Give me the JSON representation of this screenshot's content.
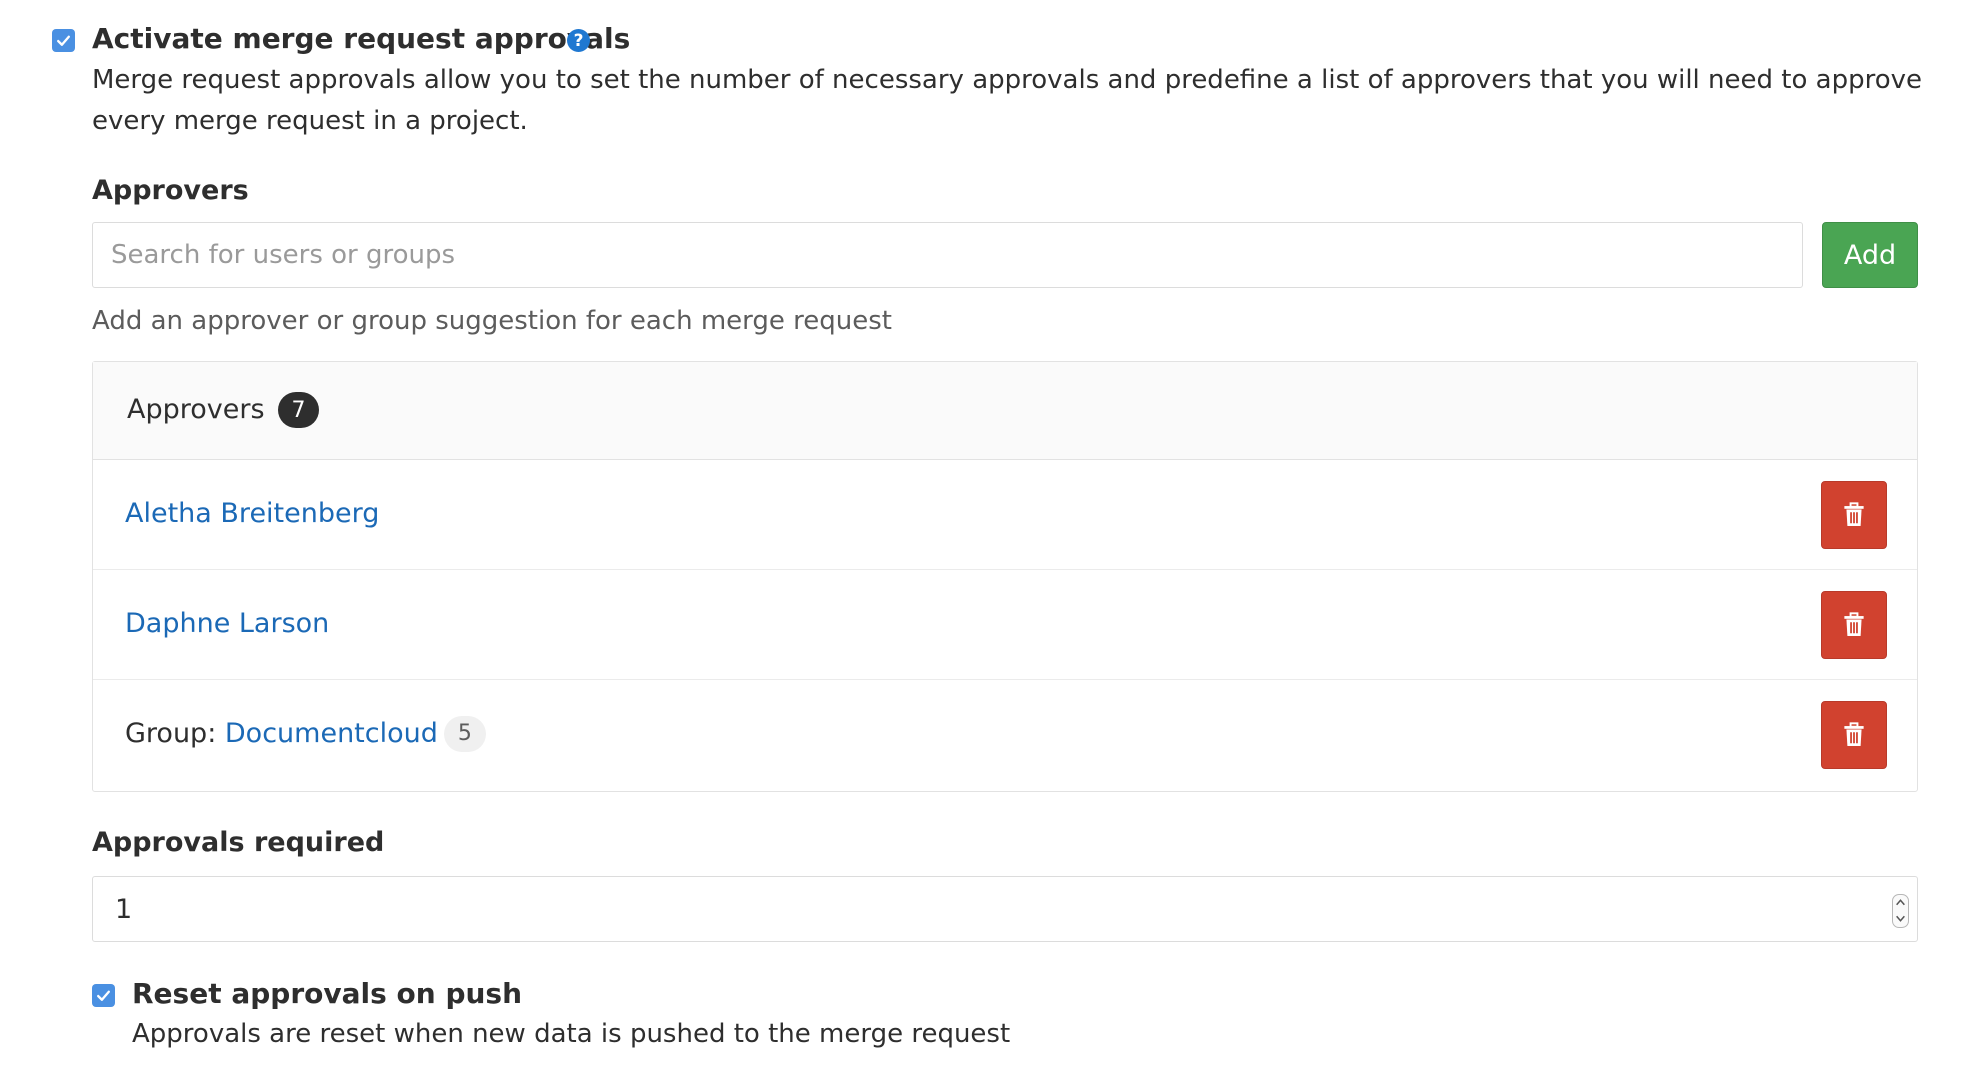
{
  "activate": {
    "checked": true,
    "title": "Activate merge request approvals",
    "help_icon": "question-circle-icon",
    "help_glyph": "?",
    "description": "Merge request approvals allow you to set the number of necessary approvals and predefine a list of approvers that you will need to approve every merge request in a project."
  },
  "approvers_section": {
    "label": "Approvers",
    "search_placeholder": "Search for users or groups",
    "add_label": "Add",
    "hint": "Add an approver or group suggestion for each merge request"
  },
  "approvers_panel": {
    "header_label": "Approvers",
    "count": "7",
    "rows": [
      {
        "prefix": "",
        "name": "Aletha Breitenberg",
        "member_count": ""
      },
      {
        "prefix": "",
        "name": "Daphne Larson",
        "member_count": ""
      },
      {
        "prefix": "Group: ",
        "name": "Documentcloud",
        "member_count": "5"
      }
    ],
    "delete_icon": "trash-icon"
  },
  "approvals_required": {
    "label": "Approvals required",
    "value": "1"
  },
  "reset_on_push": {
    "checked": true,
    "title": "Reset approvals on push",
    "description": "Approvals are reset when new data is pushed to the merge request"
  },
  "colors": {
    "checkbox": "#4a90e2",
    "link": "#1b69b6",
    "add_button": "#4aa553",
    "delete_button": "#d1422f"
  }
}
